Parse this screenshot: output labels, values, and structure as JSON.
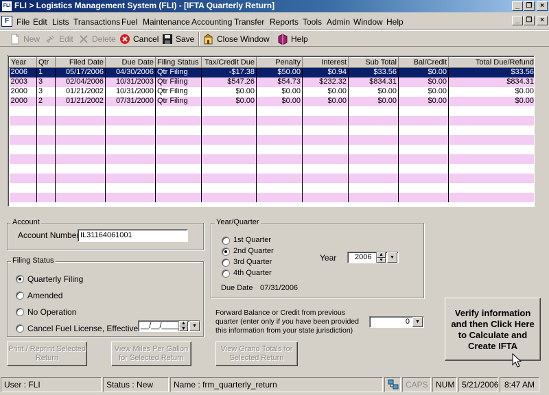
{
  "window": {
    "title": "FLI > Logistics Management System (FLI) - [IFTA Quarterly Return]",
    "app_icon": "FLI"
  },
  "menu": [
    "File",
    "Edit",
    "Lists",
    "Transactions",
    "Fuel",
    "Maintenance",
    "Accounting",
    "Transfer",
    "Reports",
    "Tools",
    "Admin",
    "Window",
    "Help"
  ],
  "toolbar": {
    "new": "New",
    "edit": "Edit",
    "delete": "Delete",
    "cancel": "Cancel",
    "save": "Save",
    "close_window": "Close Window",
    "help": "Help"
  },
  "grid": {
    "columns": [
      "Year",
      "Qtr",
      "Filed Date",
      "Due Date",
      "Filing Status",
      "Tax/Credit Due",
      "Penalty",
      "Interest",
      "Sub Total",
      "Bal/Credit",
      "Total Due/Refund"
    ],
    "rows": [
      [
        "2006",
        "1",
        "05/17/2006",
        "04/30/2006",
        "Qtr Filing",
        "-$17.38",
        "$50.00",
        "$0.94",
        "$33.56",
        "$0.00",
        "$33.56"
      ],
      [
        "2003",
        "3",
        "02/04/2006",
        "10/31/2003",
        "Qtr Filing",
        "$547.26",
        "$54.73",
        "$232.32",
        "$834.31",
        "$0.00",
        "$834.31"
      ],
      [
        "2000",
        "3",
        "01/21/2002",
        "10/31/2000",
        "Qtr Filing",
        "$0.00",
        "$0.00",
        "$0.00",
        "$0.00",
        "$0.00",
        "$0.00"
      ],
      [
        "2000",
        "2",
        "01/21/2002",
        "07/31/2000",
        "Qtr Filing",
        "$0.00",
        "$0.00",
        "$0.00",
        "$0.00",
        "$0.00",
        "$0.00"
      ]
    ],
    "selected_row": 0
  },
  "account": {
    "group_label": "Account",
    "number_label": "Account Number",
    "number_value": "IL31164061001"
  },
  "filing_status": {
    "group_label": "Filing Status",
    "options": [
      "Quarterly Filing",
      "Amended",
      "No Operation",
      "Cancel Fuel License, Effective"
    ],
    "selected": 0,
    "cancel_date": "__/__/____"
  },
  "year_quarter": {
    "group_label": "Year/Quarter",
    "options": [
      "1st Quarter",
      "2nd Quarter",
      "3rd Quarter",
      "4th Quarter"
    ],
    "selected": 1,
    "year_label": "Year",
    "year_value": "2006",
    "due_date_label": "Due Date",
    "due_date_value": "07/31/2006"
  },
  "forward_balance": {
    "label": "Forward Balance or Credit from previous quarter (enter only if you have been provided this information from your state jurisdiction)",
    "value": "0"
  },
  "buttons": {
    "print": "Print / Reprint Selected Return",
    "view_mpg": "View Miles Per Gallon for Selected Return",
    "view_totals": "View Grand Totals for Selected Return",
    "verify": "Verify information and then Click Here to Calculate and Create IFTA"
  },
  "statusbar": {
    "user": "User : FLI",
    "status": "Status : New",
    "name": "Name : frm_quarterly_return",
    "caps": "CAPS",
    "num": "NUM",
    "date": "5/21/2006",
    "time": "8:47 AM"
  },
  "colors": {
    "title_bar": "#0a246a",
    "selected_row": "#0a1f6a",
    "alt_row": "#f2ccf2",
    "window_bg": "#d4d0c8"
  },
  "icons": [
    "app-icon",
    "new-icon",
    "edit-icon",
    "delete-icon",
    "cancel-icon",
    "save-icon",
    "close-window-icon",
    "help-icon",
    "network-icon",
    "mouse-cursor-icon"
  ]
}
